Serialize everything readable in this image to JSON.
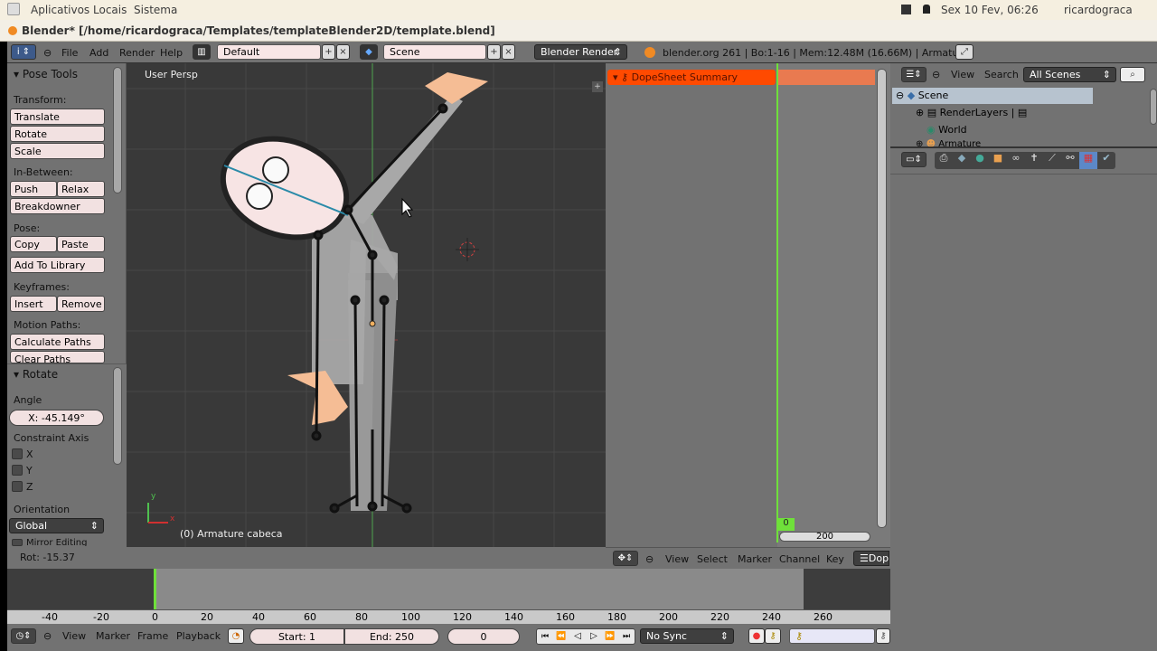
{
  "system_bar": {
    "menus": [
      "Aplicativos",
      "Locais",
      "Sistema"
    ],
    "datetime": "Sex 10 Fev, 06:26",
    "user": "ricardograca"
  },
  "window": {
    "title": "Blender* [/home/ricardograca/Templates/templateBlender2D/template.blend]"
  },
  "info_header": {
    "menus": [
      "File",
      "Add",
      "Render",
      "Help"
    ],
    "layout": "Default",
    "scene": "Scene",
    "render_engine": "Blender Render",
    "stats": "blender.org 261 | Bo:1-16  | Mem:12.48M (16.66M) | Armature"
  },
  "tool_panel": {
    "title": "Pose Tools",
    "sections": {
      "transform": {
        "label": "Transform:",
        "buttons": [
          "Translate",
          "Rotate",
          "Scale"
        ]
      },
      "inbetween": {
        "label": "In-Between:",
        "buttons": [
          "Push",
          "Relax",
          "Breakdowner"
        ]
      },
      "pose": {
        "label": "Pose:",
        "buttons": [
          "Copy",
          "Paste",
          "Add To Library"
        ]
      },
      "keyframes": {
        "label": "Keyframes:",
        "buttons": [
          "Insert",
          "Remove"
        ]
      },
      "motion_paths": {
        "label": "Motion Paths:",
        "buttons": [
          "Calculate Paths",
          "Clear Paths"
        ]
      }
    }
  },
  "operator_panel": {
    "title": "Rotate",
    "angle_label": "Angle",
    "angle_value": "X: -45.149°",
    "constraint_label": "Constraint Axis",
    "axes": [
      {
        "label": "X",
        "checked": false
      },
      {
        "label": "Y",
        "checked": false
      },
      {
        "label": "Z",
        "checked": false
      }
    ],
    "orientation_label": "Orientation",
    "orientation_value": "Global",
    "mirror_label": "Mirror Editing"
  },
  "viewport": {
    "view_name": "User Persp",
    "object_info": "(0) Armature cabeca",
    "axis_x": "x",
    "axis_y": "y"
  },
  "status": {
    "rot": "Rot: -15.37"
  },
  "dopesheet": {
    "summary": "DopeSheet Summary",
    "current_frame": "0",
    "scroll_value": "200",
    "menus": [
      "View",
      "Select",
      "Marker",
      "Channel",
      "Key"
    ],
    "mode": "Dope"
  },
  "outliner": {
    "menus": [
      "View",
      "Search"
    ],
    "filter": "All Scenes",
    "items": [
      {
        "label": "Scene",
        "level": 0,
        "expanded": true
      },
      {
        "label": "RenderLayers",
        "level": 1,
        "expanded": false
      },
      {
        "label": "World",
        "level": 1
      },
      {
        "label": "Armature",
        "level": 1,
        "expanded": false
      }
    ]
  },
  "timeline": {
    "ruler_ticks": [
      "-40",
      "-20",
      "0",
      "20",
      "40",
      "60",
      "80",
      "100",
      "120",
      "140",
      "160",
      "180",
      "200",
      "220",
      "240",
      "260"
    ],
    "menus": [
      "View",
      "Marker",
      "Frame",
      "Playback"
    ],
    "start": "Start: 1",
    "end": "End: 250",
    "current": "0",
    "sync": "No Sync"
  },
  "colors": {
    "accent_orange": "#ff4a00",
    "frame_green": "#6fe03a",
    "panel_grey": "#727272"
  }
}
